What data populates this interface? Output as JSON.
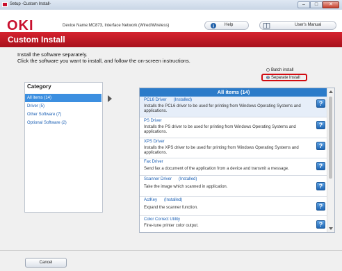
{
  "window": {
    "title": "Setup -Custom Install-",
    "min_glyph": "–",
    "max_glyph": "□",
    "close_glyph": "✕"
  },
  "header": {
    "logo": "OKI",
    "device_info": "Device Name:MC873, Interface Network (Wired/Wireless)",
    "help_label": "Help",
    "manual_label": "User's Manual"
  },
  "banner": {
    "title": "Custom Install"
  },
  "instructions": {
    "line1": "Install the software separately.",
    "line2": "Click the software you want to install, and follow the on-screen instructions."
  },
  "install_mode": {
    "options": [
      "Batch install",
      "Separate Install"
    ],
    "selected": "Separate Install"
  },
  "category": {
    "heading": "Category",
    "items": [
      "All items (14)",
      "Driver (5)",
      "Other Software (7)",
      "Optional Software (2)"
    ],
    "selected_index": 0
  },
  "panel": {
    "header": "All items (14)",
    "items": [
      {
        "name": "PCL6 Driver",
        "status": "(Installed)",
        "desc": "Installs the PCL6 driver to be used for printing from Windows Operating Systems and applications."
      },
      {
        "name": "PS Driver",
        "status": "",
        "desc": "Installs the PS driver to be used for printing from Windows Operating Systems and applications."
      },
      {
        "name": "XPS Driver",
        "status": "",
        "desc": "Installs the XPS driver to be used for printing from Windows Operating Systems and applications."
      },
      {
        "name": "Fax Driver",
        "status": "",
        "desc": "Send fax a document of the application from a device and transmit a message."
      },
      {
        "name": "Scanner Driver",
        "status": "(Installed)",
        "desc": "Take the image which scanned in application."
      },
      {
        "name": "ActKey",
        "status": "(Installed)",
        "desc": "Expand the scanner function."
      },
      {
        "name": "Color Correct Utility",
        "status": "",
        "desc": "Fine-tune printer color output."
      }
    ]
  },
  "footer": {
    "cancel_label": "Cancel"
  },
  "colors": {
    "brand_red": "#c8102e",
    "accent_blue": "#2b7bc9",
    "highlight_red": "#d10a10"
  }
}
